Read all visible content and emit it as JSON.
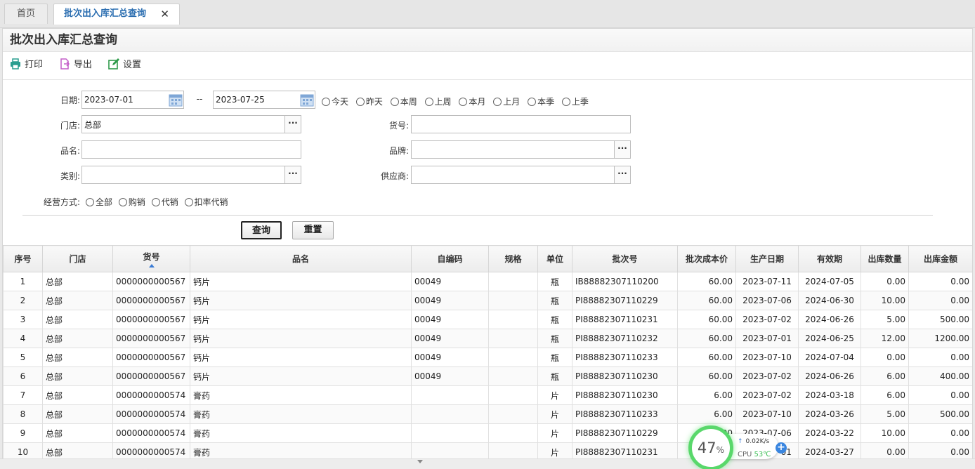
{
  "tabs": {
    "home": "首页",
    "active": "批次出入库汇总查询",
    "close": "✕"
  },
  "page": {
    "title": "批次出入库汇总查询"
  },
  "toolbar": {
    "print": "打印",
    "export": "导出",
    "settings": "设置"
  },
  "form": {
    "date_label": "日期:",
    "date_from": "2023-07-01",
    "date_sep": "--",
    "date_to": "2023-07-25",
    "quick_ranges": [
      "今天",
      "昨天",
      "本周",
      "上周",
      "本月",
      "上月",
      "本季",
      "上季"
    ],
    "store_label": "门店:",
    "store_value": "总部",
    "item_no_label": "货号:",
    "item_no_value": "",
    "name_label": "品名:",
    "name_value": "",
    "brand_label": "品牌:",
    "brand_value": "",
    "category_label": "类别:",
    "category_value": "",
    "supplier_label": "供应商:",
    "supplier_value": "",
    "mode_label": "经营方式:",
    "modes": [
      "全部",
      "购销",
      "代销",
      "扣率代销"
    ],
    "dots": "···",
    "query_button": "查询",
    "reset_button": "重置"
  },
  "grid": {
    "columns": [
      "序号",
      "门店",
      "货号",
      "品名",
      "自编码",
      "规格",
      "单位",
      "批次号",
      "批次成本价",
      "生产日期",
      "有效期",
      "出库数量",
      "出库金额"
    ],
    "rows": [
      [
        "1",
        "总部",
        "0000000000567",
        "钙片",
        "00049",
        "",
        "瓶",
        "IB88882307110200",
        "60.00",
        "2023-07-11",
        "2024-07-05",
        "0.00",
        "0.00"
      ],
      [
        "2",
        "总部",
        "0000000000567",
        "钙片",
        "00049",
        "",
        "瓶",
        "PI88882307110229",
        "60.00",
        "2023-07-06",
        "2024-06-30",
        "10.00",
        "0.00"
      ],
      [
        "3",
        "总部",
        "0000000000567",
        "钙片",
        "00049",
        "",
        "瓶",
        "PI88882307110231",
        "60.00",
        "2023-07-02",
        "2024-06-26",
        "5.00",
        "500.00"
      ],
      [
        "4",
        "总部",
        "0000000000567",
        "钙片",
        "00049",
        "",
        "瓶",
        "PI88882307110232",
        "60.00",
        "2023-07-01",
        "2024-06-25",
        "12.00",
        "1200.00"
      ],
      [
        "5",
        "总部",
        "0000000000567",
        "钙片",
        "00049",
        "",
        "瓶",
        "PI88882307110233",
        "60.00",
        "2023-07-10",
        "2024-07-04",
        "0.00",
        "0.00"
      ],
      [
        "6",
        "总部",
        "0000000000567",
        "钙片",
        "00049",
        "",
        "瓶",
        "PI88882307110230",
        "60.00",
        "2023-07-02",
        "2024-06-26",
        "6.00",
        "400.00"
      ],
      [
        "7",
        "总部",
        "0000000000574",
        "膏药",
        "",
        "",
        "片",
        "PI88882307110230",
        "6.00",
        "2023-07-02",
        "2024-03-18",
        "6.00",
        "0.00"
      ],
      [
        "8",
        "总部",
        "0000000000574",
        "膏药",
        "",
        "",
        "片",
        "PI88882307110233",
        "6.00",
        "2023-07-10",
        "2024-03-26",
        "5.00",
        "500.00"
      ],
      [
        "9",
        "总部",
        "0000000000574",
        "膏药",
        "",
        "",
        "片",
        "PI88882307110229",
        "6.00",
        "2023-07-06",
        "2024-03-22",
        "10.00",
        "0.00"
      ],
      [
        "10",
        "总部",
        "0000000000574",
        "膏药",
        "",
        "",
        "片",
        "PI88882307110231",
        "6.00",
        "2023-07-01",
        "2024-03-27",
        "0.00",
        "0.00"
      ]
    ]
  },
  "perf": {
    "percent": "47",
    "percent_sign": "%",
    "net": "0.02K/s",
    "cpu_label": "CPU",
    "cpu_temp": "53℃"
  },
  "colors": {
    "accent": "#2a6db0",
    "ring": "#59d86b"
  }
}
